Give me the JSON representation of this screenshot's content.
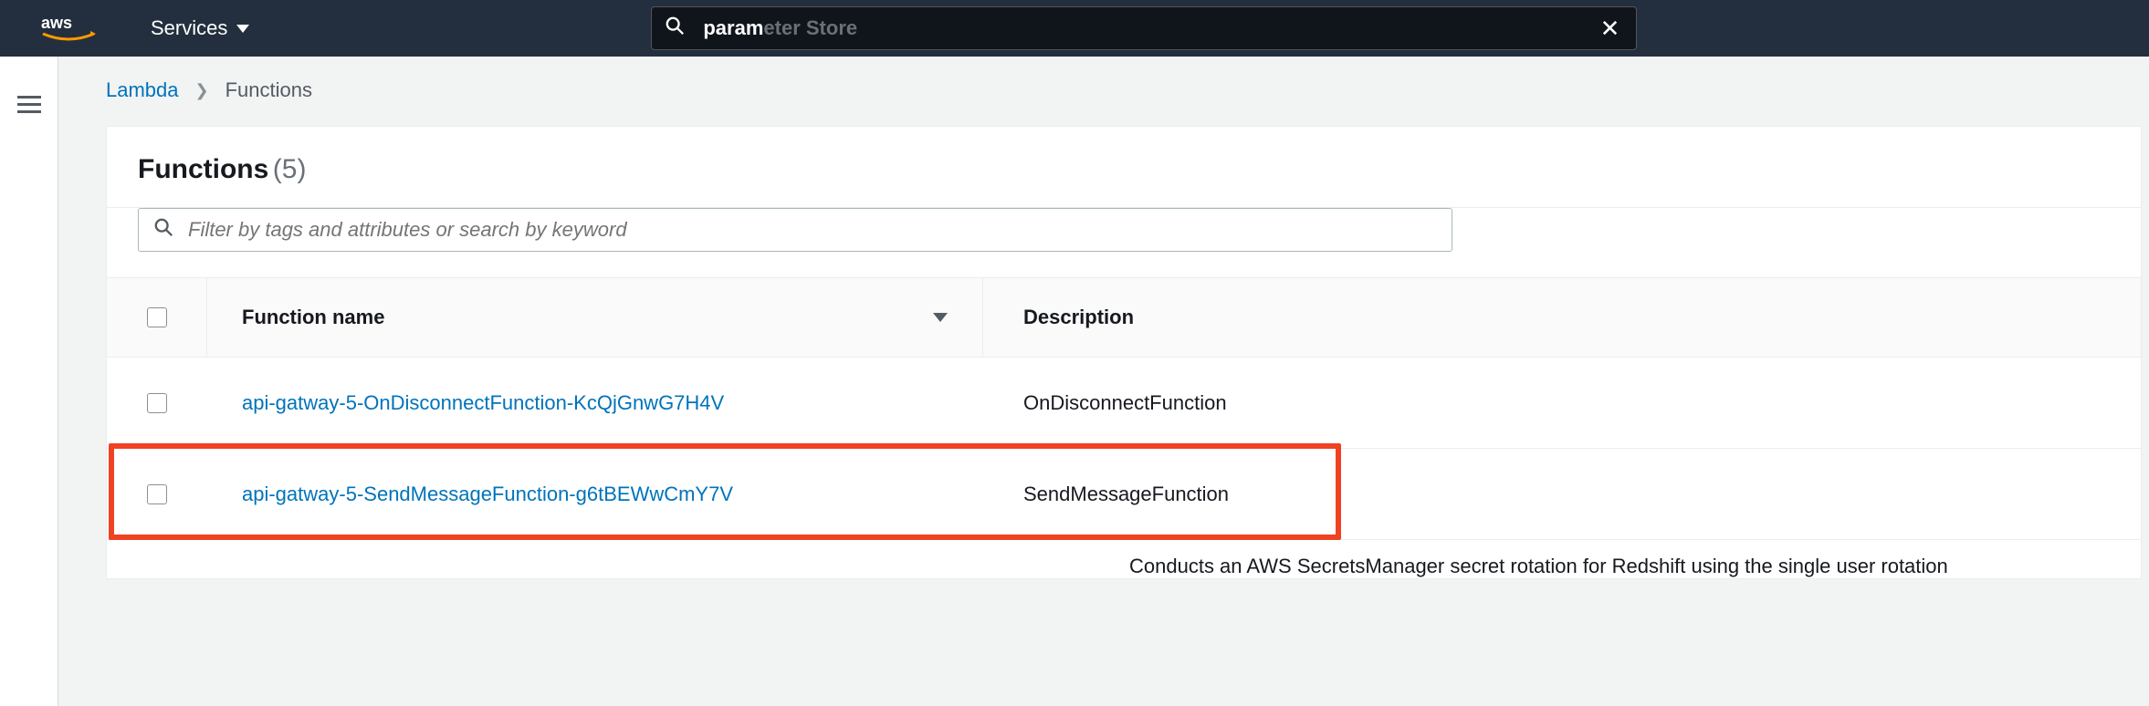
{
  "topnav": {
    "services_label": "Services",
    "search_typed": "param",
    "search_hint": "eter Store"
  },
  "breadcrumb": {
    "root": "Lambda",
    "current": "Functions"
  },
  "panel": {
    "title": "Functions",
    "count_display": "(5)",
    "filter_placeholder": "Filter by tags and attributes or search by keyword",
    "columns": {
      "function_name": "Function name",
      "description": "Description"
    },
    "rows": [
      {
        "name": "api-gatway-5-OnDisconnectFunction-KcQjGnwG7H4V",
        "description": "OnDisconnectFunction",
        "highlighted": false
      },
      {
        "name": "api-gatway-5-SendMessageFunction-g6tBEWwCmY7V",
        "description": "SendMessageFunction",
        "highlighted": true
      }
    ],
    "truncated_row_text": "Conducts an AWS SecretsManager secret rotation for Redshift using the single user rotation"
  }
}
